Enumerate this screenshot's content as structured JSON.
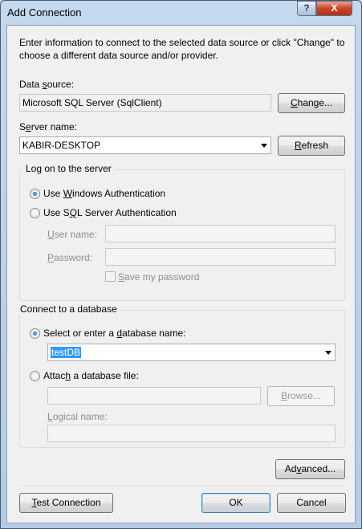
{
  "window": {
    "title": "Add Connection",
    "help_glyph": "?",
    "close_glyph": "X"
  },
  "intro": "Enter information to connect to the selected data source or click \"Change\" to choose a different data source and/or provider.",
  "data_source": {
    "label_pre": "Data ",
    "label_key": "s",
    "label_post": "ource:",
    "value": "Microsoft SQL Server (SqlClient)",
    "change_pre": "",
    "change_key": "C",
    "change_post": "hange..."
  },
  "server": {
    "label_pre": "S",
    "label_key": "e",
    "label_post": "rver name:",
    "value": "KABIR-DESKTOP",
    "refresh_pre": "",
    "refresh_key": "R",
    "refresh_post": "efresh"
  },
  "logon": {
    "group_title": "Log on to the server",
    "windows_auth_pre": "Use ",
    "windows_auth_key": "W",
    "windows_auth_post": "indows Authentication",
    "windows_auth_selected": true,
    "sql_auth_pre": "Use S",
    "sql_auth_key": "Q",
    "sql_auth_post": "L Server Authentication",
    "sql_auth_selected": false,
    "user_pre": "",
    "user_key": "U",
    "user_post": "ser name:",
    "password_pre": "",
    "password_key": "P",
    "password_post": "assword:",
    "save_pre": "",
    "save_key": "S",
    "save_post": "ave my password",
    "save_checked": false
  },
  "database": {
    "group_title": "Connect to a database",
    "select_pre": "Select or enter a ",
    "select_key": "d",
    "select_post": "atabase name:",
    "select_selected": true,
    "db_name": "testDB",
    "attach_pre": "Attac",
    "attach_key": "h",
    "attach_post": " a database file:",
    "attach_selected": false,
    "browse_pre": "",
    "browse_key": "B",
    "browse_post": "rowse...",
    "logical_pre": "",
    "logical_key": "L",
    "logical_post": "ogical name:"
  },
  "buttons": {
    "advanced_pre": "Ad",
    "advanced_key": "v",
    "advanced_post": "anced...",
    "test_pre": "",
    "test_key": "T",
    "test_post": "est Connection",
    "ok": "OK",
    "cancel": "Cancel"
  }
}
